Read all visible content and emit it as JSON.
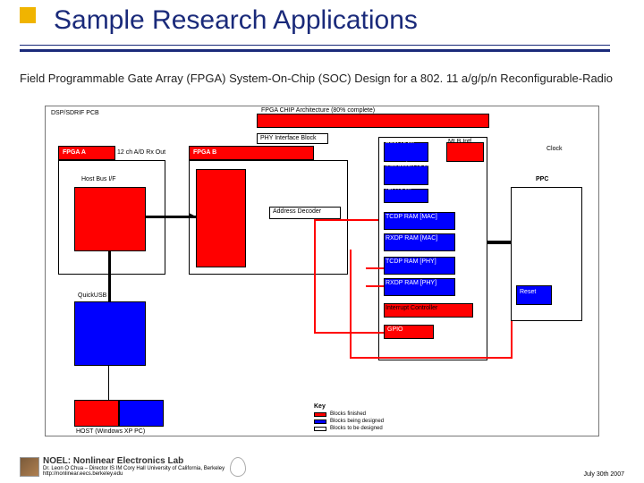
{
  "title": "Sample Research Applications",
  "subtitle": "Field Programmable Gate Array (FPGA) System-On-Chip (SOC) Design for a 802. 11 a/g/p/n Reconfigurable-Radio",
  "diagram": {
    "header_left": "DSP/SDRIF PCB",
    "bar_fpga": "FPGA CHIP Architecture (80% complete)",
    "fpga_a": {
      "title": "FPGA A"
    },
    "fpga_b": {
      "title": "FPGA B"
    },
    "blocks": {
      "decA": "12 ch A/D Rx Out",
      "hostbus": "Host Bus I/F",
      "quickusb": "QuickUSB",
      "phy": "PHY Interface Block",
      "plb": "PLB MASTER SOC BUS Interface",
      "addrdec": "Address Decoder",
      "bootram": "Boot RAM",
      "instr": "Instruction RAM",
      "icaram": "ICA RAM",
      "tcpram_mac": "TCDP RAM [MAC]",
      "rxdpram_mac": "RXDP RAM [MAC]",
      "tcpram_phy": "TCDP RAM [PHY]",
      "rxdpram_phy": "RXDP RAM [PHY]",
      "intctrl": "Interrupt Controller",
      "gpio": "GPIO",
      "mlb": "MLB Intf.",
      "ppc": "PPC",
      "clock": "Clock",
      "reset": "Reset",
      "host_bottom": "HOST (Windows XP PC)"
    },
    "legend": {
      "title": "Key",
      "items": [
        {
          "color": "#ff0000",
          "label": "Blocks finished"
        },
        {
          "color": "#0000ff",
          "label": "Blocks being designed"
        },
        {
          "color": "#ffffff",
          "label": "Blocks to be designed"
        }
      ]
    }
  },
  "footer": {
    "lab": "NOEL: Nonlinear Electronics Lab",
    "credit1": "Dr. Leon O Chua – Director IS IM Cory Hall University of California, Berkeley",
    "credit2": "http://nonlinear.eecs.berkeley.edu",
    "date": "July 30th 2007"
  }
}
